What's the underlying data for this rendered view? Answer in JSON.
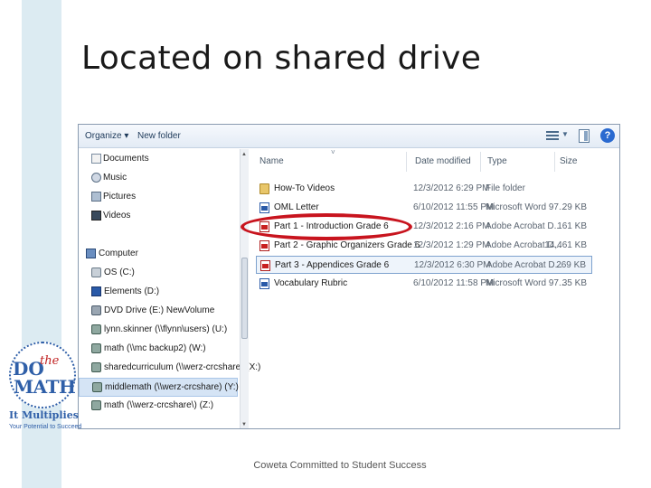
{
  "slide": {
    "title": "Located on shared drive",
    "footer": "Coweta Committed to Student Success"
  },
  "toolbar": {
    "organize_label": "Organize ▾",
    "new_folder_label": "New folder",
    "help_label": "?"
  },
  "nav": {
    "items": [
      {
        "label": "Documents",
        "icon": "documents-icon"
      },
      {
        "label": "Music",
        "icon": "music-icon"
      },
      {
        "label": "Pictures",
        "icon": "pictures-icon"
      },
      {
        "label": "Videos",
        "icon": "videos-icon"
      },
      {
        "label": "Computer",
        "icon": "computer-icon"
      },
      {
        "label": "OS (C:)",
        "icon": "hard-drive-icon"
      },
      {
        "label": "Elements (D:)",
        "icon": "drive-icon"
      },
      {
        "label": "DVD Drive (E:) NewVolume",
        "icon": "dvd-drive-icon"
      },
      {
        "label": "lynn.skinner (\\\\flynn\\users) (U:)",
        "icon": "network-drive-icon"
      },
      {
        "label": "math (\\\\mc backup2) (W:)",
        "icon": "network-drive-icon"
      },
      {
        "label": "sharedcurriculum (\\\\werz-crcshare) (X:)",
        "icon": "network-drive-icon"
      },
      {
        "label": "middlemath (\\\\werz-crcshare) (Y:)",
        "icon": "network-drive-icon",
        "selected": true
      },
      {
        "label": "math (\\\\werz-crcshare\\) (Z:)",
        "icon": "network-drive-icon"
      }
    ]
  },
  "filelist": {
    "columns": {
      "name": "Name",
      "date": "Date modified",
      "type": "Type",
      "size": "Size"
    },
    "rows": [
      {
        "name": "How-To Videos",
        "date": "12/3/2012 6:29 PM",
        "type": "File folder",
        "size": "",
        "icon": "folder-icon"
      },
      {
        "name": "OML Letter",
        "date": "6/10/2012 11:55 PM",
        "type": "Microsoft Word 97...",
        "size": "29 KB",
        "icon": "word-document-icon"
      },
      {
        "name": "Part 1 - Introduction Grade 6",
        "date": "12/3/2012 2:16 PM",
        "type": "Adobe Acrobat D...",
        "size": "161 KB",
        "icon": "pdf-icon"
      },
      {
        "name": "Part 2 - Graphic Organizers Grade 6",
        "date": "12/3/2012 1:29 PM",
        "type": "Adobe Acrobat D...",
        "size": "14,461 KB",
        "icon": "pdf-icon"
      },
      {
        "name": "Part 3 - Appendices Grade 6",
        "date": "12/3/2012 6:30 PM",
        "type": "Adobe Acrobat D...",
        "size": "269 KB",
        "icon": "pdf-icon",
        "selected": true
      },
      {
        "name": "Vocabulary Rubric",
        "date": "6/10/2012 11:58 PM",
        "type": "Microsoft Word 97...",
        "size": "35 KB",
        "icon": "word-document-icon"
      }
    ]
  },
  "logo": {
    "do": "DO",
    "the": "the",
    "math": "MATH",
    "tagline": "It Multiplies",
    "subline": "Your Potential to Succeed"
  },
  "colors": {
    "accent_stripe": "#dcebf2",
    "highlight_oval": "#c8141e",
    "selection": "#d5e4f5"
  }
}
